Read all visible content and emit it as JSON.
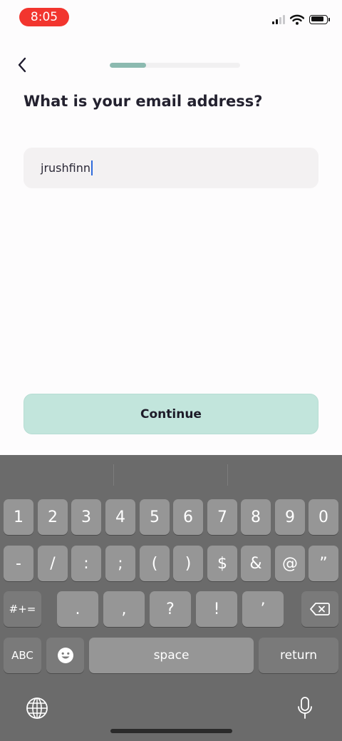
{
  "status_bar": {
    "time": "8:05"
  },
  "header": {
    "progress_fraction": 0.28
  },
  "page": {
    "title": "What is your email address?",
    "email_value": "jrushfinn",
    "continue_label": "Continue"
  },
  "keyboard": {
    "row1": [
      "1",
      "2",
      "3",
      "4",
      "5",
      "6",
      "7",
      "8",
      "9",
      "0"
    ],
    "row2": [
      "-",
      "/",
      ":",
      ";",
      "(",
      ")",
      "$",
      "&",
      "@",
      "”"
    ],
    "row3": {
      "shift_label": "#+=",
      "keys": [
        ".",
        ",",
        "?",
        "!",
        "’"
      ]
    },
    "row4": {
      "abc_label": "ABC",
      "space_label": "space",
      "return_label": "return"
    }
  },
  "colors": {
    "time_pill": "#f2352e",
    "progress_fill": "#8cbab0",
    "continue_bg": "#c2e5dc",
    "caret": "#2f6bdc",
    "keyboard_bg": "#6b6b6b"
  },
  "icons": [
    "back-chevron-icon",
    "signal-icon",
    "wifi-icon",
    "battery-icon",
    "delete-icon",
    "emoji-icon",
    "globe-icon",
    "microphone-icon"
  ]
}
